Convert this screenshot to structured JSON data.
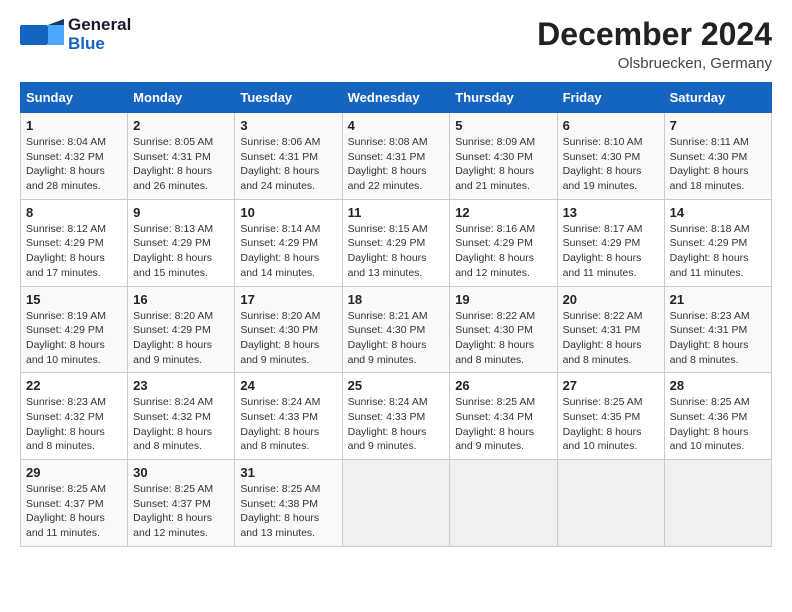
{
  "header": {
    "logo_line1": "General",
    "logo_line2": "Blue",
    "month": "December 2024",
    "location": "Olsbruecken, Germany"
  },
  "weekdays": [
    "Sunday",
    "Monday",
    "Tuesday",
    "Wednesday",
    "Thursday",
    "Friday",
    "Saturday"
  ],
  "weeks": [
    [
      {
        "day": "1",
        "sunrise": "8:04 AM",
        "sunset": "4:32 PM",
        "daylight": "8 hours and 28 minutes."
      },
      {
        "day": "2",
        "sunrise": "8:05 AM",
        "sunset": "4:31 PM",
        "daylight": "8 hours and 26 minutes."
      },
      {
        "day": "3",
        "sunrise": "8:06 AM",
        "sunset": "4:31 PM",
        "daylight": "8 hours and 24 minutes."
      },
      {
        "day": "4",
        "sunrise": "8:08 AM",
        "sunset": "4:31 PM",
        "daylight": "8 hours and 22 minutes."
      },
      {
        "day": "5",
        "sunrise": "8:09 AM",
        "sunset": "4:30 PM",
        "daylight": "8 hours and 21 minutes."
      },
      {
        "day": "6",
        "sunrise": "8:10 AM",
        "sunset": "4:30 PM",
        "daylight": "8 hours and 19 minutes."
      },
      {
        "day": "7",
        "sunrise": "8:11 AM",
        "sunset": "4:30 PM",
        "daylight": "8 hours and 18 minutes."
      }
    ],
    [
      {
        "day": "8",
        "sunrise": "8:12 AM",
        "sunset": "4:29 PM",
        "daylight": "8 hours and 17 minutes."
      },
      {
        "day": "9",
        "sunrise": "8:13 AM",
        "sunset": "4:29 PM",
        "daylight": "8 hours and 15 minutes."
      },
      {
        "day": "10",
        "sunrise": "8:14 AM",
        "sunset": "4:29 PM",
        "daylight": "8 hours and 14 minutes."
      },
      {
        "day": "11",
        "sunrise": "8:15 AM",
        "sunset": "4:29 PM",
        "daylight": "8 hours and 13 minutes."
      },
      {
        "day": "12",
        "sunrise": "8:16 AM",
        "sunset": "4:29 PM",
        "daylight": "8 hours and 12 minutes."
      },
      {
        "day": "13",
        "sunrise": "8:17 AM",
        "sunset": "4:29 PM",
        "daylight": "8 hours and 11 minutes."
      },
      {
        "day": "14",
        "sunrise": "8:18 AM",
        "sunset": "4:29 PM",
        "daylight": "8 hours and 11 minutes."
      }
    ],
    [
      {
        "day": "15",
        "sunrise": "8:19 AM",
        "sunset": "4:29 PM",
        "daylight": "8 hours and 10 minutes."
      },
      {
        "day": "16",
        "sunrise": "8:20 AM",
        "sunset": "4:29 PM",
        "daylight": "8 hours and 9 minutes."
      },
      {
        "day": "17",
        "sunrise": "8:20 AM",
        "sunset": "4:30 PM",
        "daylight": "8 hours and 9 minutes."
      },
      {
        "day": "18",
        "sunrise": "8:21 AM",
        "sunset": "4:30 PM",
        "daylight": "8 hours and 9 minutes."
      },
      {
        "day": "19",
        "sunrise": "8:22 AM",
        "sunset": "4:30 PM",
        "daylight": "8 hours and 8 minutes."
      },
      {
        "day": "20",
        "sunrise": "8:22 AM",
        "sunset": "4:31 PM",
        "daylight": "8 hours and 8 minutes."
      },
      {
        "day": "21",
        "sunrise": "8:23 AM",
        "sunset": "4:31 PM",
        "daylight": "8 hours and 8 minutes."
      }
    ],
    [
      {
        "day": "22",
        "sunrise": "8:23 AM",
        "sunset": "4:32 PM",
        "daylight": "8 hours and 8 minutes."
      },
      {
        "day": "23",
        "sunrise": "8:24 AM",
        "sunset": "4:32 PM",
        "daylight": "8 hours and 8 minutes."
      },
      {
        "day": "24",
        "sunrise": "8:24 AM",
        "sunset": "4:33 PM",
        "daylight": "8 hours and 8 minutes."
      },
      {
        "day": "25",
        "sunrise": "8:24 AM",
        "sunset": "4:33 PM",
        "daylight": "8 hours and 9 minutes."
      },
      {
        "day": "26",
        "sunrise": "8:25 AM",
        "sunset": "4:34 PM",
        "daylight": "8 hours and 9 minutes."
      },
      {
        "day": "27",
        "sunrise": "8:25 AM",
        "sunset": "4:35 PM",
        "daylight": "8 hours and 10 minutes."
      },
      {
        "day": "28",
        "sunrise": "8:25 AM",
        "sunset": "4:36 PM",
        "daylight": "8 hours and 10 minutes."
      }
    ],
    [
      {
        "day": "29",
        "sunrise": "8:25 AM",
        "sunset": "4:37 PM",
        "daylight": "8 hours and 11 minutes."
      },
      {
        "day": "30",
        "sunrise": "8:25 AM",
        "sunset": "4:37 PM",
        "daylight": "8 hours and 12 minutes."
      },
      {
        "day": "31",
        "sunrise": "8:25 AM",
        "sunset": "4:38 PM",
        "daylight": "8 hours and 13 minutes."
      },
      null,
      null,
      null,
      null
    ]
  ]
}
